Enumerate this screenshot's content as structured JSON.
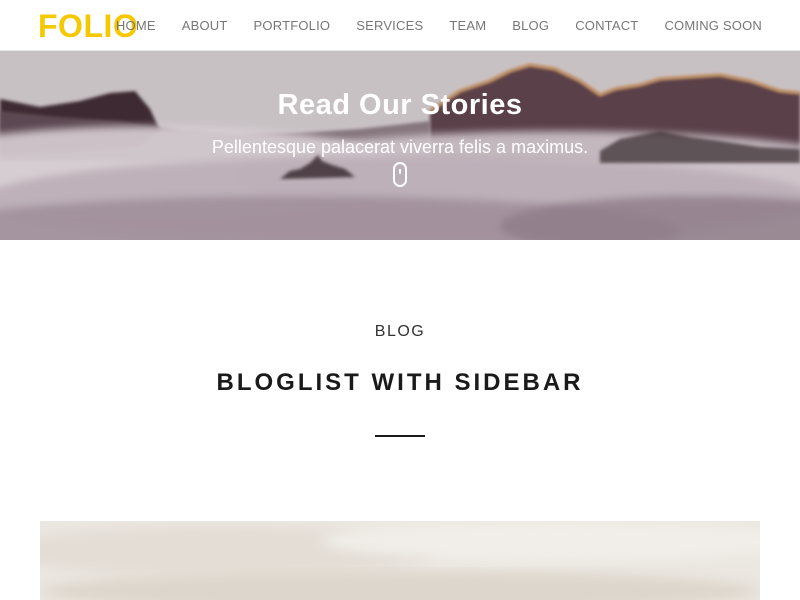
{
  "brand": {
    "logo": "FOLIO",
    "accent_color": "#f5c800"
  },
  "nav": {
    "text_color": "#777777",
    "items": [
      {
        "label": "HOME"
      },
      {
        "label": "ABOUT"
      },
      {
        "label": "PORTFOLIO"
      },
      {
        "label": "SERVICES"
      },
      {
        "label": "TEAM"
      },
      {
        "label": "BLOG"
      },
      {
        "label": "CONTACT"
      },
      {
        "label": "COMING SOON"
      }
    ]
  },
  "hero": {
    "title": "Read Our Stories",
    "subtitle": "Pellentesque palacerat viverra felis a maximus.",
    "scroll_icon": "mouse-scroll-icon"
  },
  "section": {
    "label": "BLOG",
    "title": "BLOGLIST WITH SIDEBAR"
  }
}
